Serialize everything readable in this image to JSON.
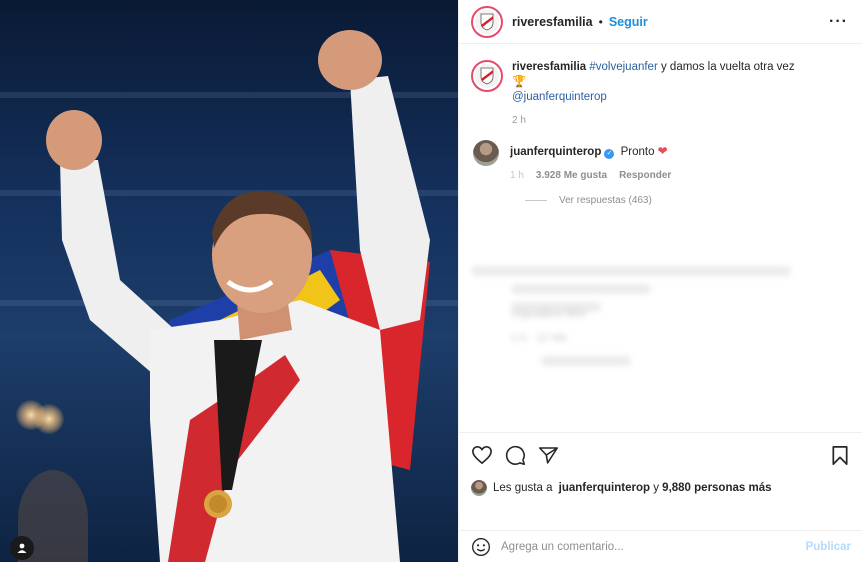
{
  "post": {
    "author": "riveresfamilia",
    "dot": "•",
    "follow_label": "Seguir",
    "more_label": "···"
  },
  "caption": {
    "user": "riveresfamilia",
    "hashtag": "#volvejuanfer",
    "text": " y damos la vuelta otra vez ",
    "trophy": "🏆",
    "mention": "@juanferquinterop",
    "time": "2 h"
  },
  "top_comment": {
    "user": "juanferquinterop",
    "verified_glyph": "✓",
    "text": "Pronto",
    "heart": "❤",
    "time": "1 h",
    "likes": "3.928 Me gusta",
    "reply_label": "Responder",
    "view_replies": "Ver respuestas (463)"
  },
  "blurred_comment": {
    "user": "migueljbra Mire",
    "meta": "1 h · 12 Me"
  },
  "likes": {
    "prefix": "Les gusta a ",
    "user": "juanferquinterop",
    "middle": " y ",
    "count": "9,880 personas más"
  },
  "comment_box": {
    "placeholder": "Agrega un comentario...",
    "publish_label": "Publicar"
  },
  "colors": {
    "follow": "#1a8fe0",
    "verified": "#3897f0",
    "heart": "#ed4956",
    "publish_disabled": "#b3dbff"
  }
}
